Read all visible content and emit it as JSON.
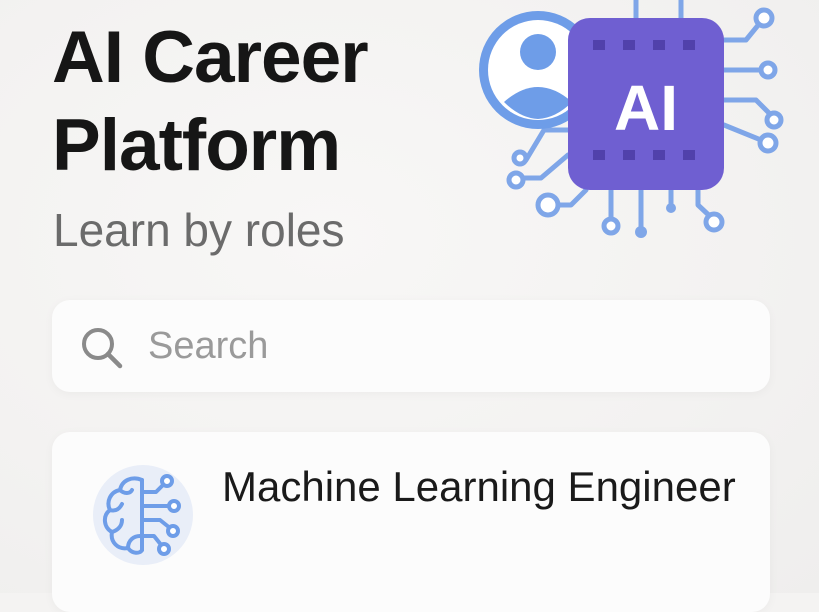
{
  "header": {
    "title": "AI Career Platform",
    "subtitle": "Learn by roles",
    "hero_badge_text": "AI",
    "hero_icons": [
      "user-icon",
      "ai-chip-icon"
    ]
  },
  "search": {
    "placeholder": "Search",
    "value": "",
    "icon": "search-icon"
  },
  "roles": [
    {
      "title": "Machine Learning Engineer",
      "icon": "brain-circuit-icon"
    }
  ],
  "colors": {
    "background": "#f4f3f2",
    "title_text": "#161616",
    "subtitle_text": "#6b6b6b",
    "placeholder_text": "#9a9a9a",
    "avatar_blue": "#6e9de8",
    "chip_purple": "#6f5fd1",
    "circuit_blue": "#7fa6e8"
  }
}
